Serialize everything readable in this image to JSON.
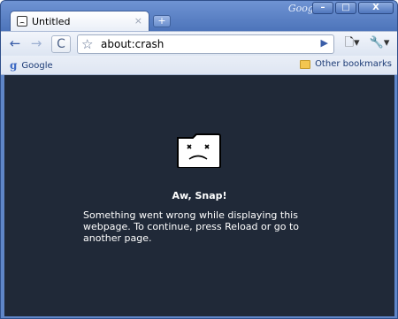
{
  "window": {
    "brand": "Google",
    "minimize": "–",
    "maximize": "□",
    "close": "X"
  },
  "tab": {
    "title": "Untitled",
    "close": "×",
    "new_tab": "+"
  },
  "toolbar": {
    "back": "←",
    "forward": "→",
    "reload": "C",
    "url": "about:crash",
    "go": "▶",
    "page_menu": "🗋▾",
    "tools_menu": "🔧▾"
  },
  "bookmarks": {
    "google_icon": "g",
    "google": "Google",
    "other": "Other bookmarks"
  },
  "crash": {
    "heading": "Aw, Snap!",
    "message": "Something went wrong while displaying this webpage. To continue, press Reload or go to another page."
  }
}
